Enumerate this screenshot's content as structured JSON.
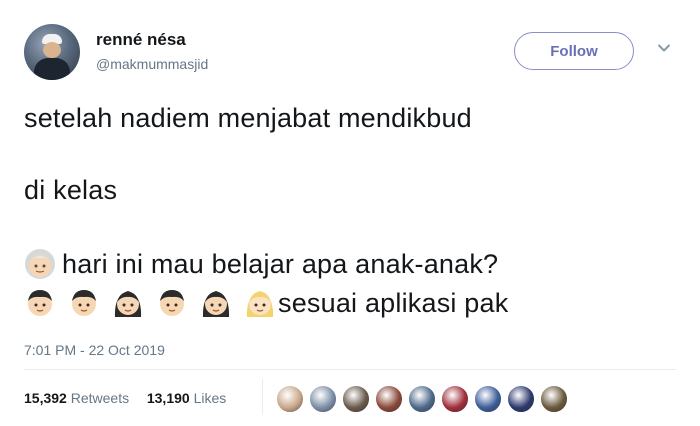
{
  "user": {
    "display_name": "renné nésa",
    "handle": "@makmummasjid",
    "avatar_icon": "profile-photo"
  },
  "header": {
    "follow_label": "Follow",
    "more_icon": "chevron-down-icon"
  },
  "tweet": {
    "line1": "setelah nadiem menjabat mendikbud",
    "line2": "di kelas",
    "line3_text": "hari ini mau belajar apa anak-anak?",
    "line4_text": "sesuai aplikasi pak",
    "line3_emoji": "older-person-emoji",
    "line4_emojis": [
      "boy-emoji",
      "boy-emoji",
      "girl-emoji",
      "boy-emoji",
      "girl-emoji",
      "blond-girl-emoji"
    ]
  },
  "timestamp": "7:01 PM - 22 Oct 2019",
  "stats": {
    "retweets_count": "15,392",
    "retweets_label": "Retweets",
    "likes_count": "13,190",
    "likes_label": "Likes"
  },
  "liked_by_avatars": [
    {
      "color": "#c9a88a"
    },
    {
      "color": "#7d8fa8"
    },
    {
      "color": "#6a5a4c"
    },
    {
      "color": "#8a4a3a"
    },
    {
      "color": "#4d6a8c"
    },
    {
      "color": "#a0303c"
    },
    {
      "color": "#3d5e9a"
    },
    {
      "color": "#2e3a6e"
    },
    {
      "color": "#6b5a3e"
    }
  ],
  "colors": {
    "follow_accent": "#6a6fb8",
    "muted_text": "#657786",
    "primary_text": "#14171a"
  }
}
